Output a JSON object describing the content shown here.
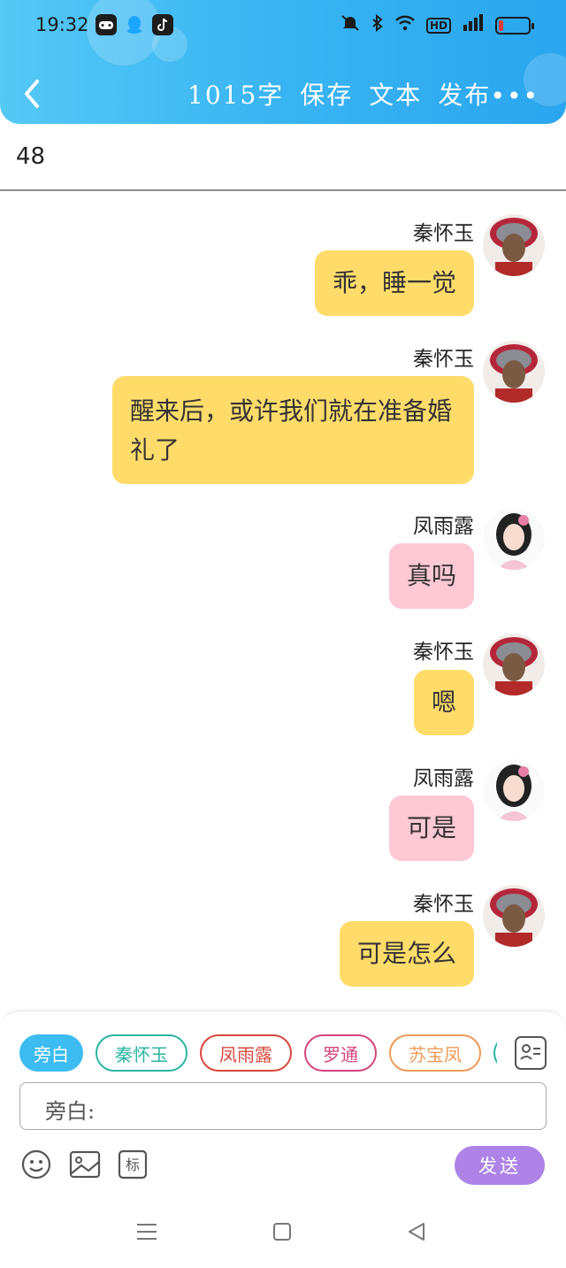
{
  "status_bar": {
    "time": "19:32",
    "left_icons": [
      "gamepad-icon",
      "qq-icon",
      "tiktok-icon"
    ],
    "right_icons": [
      "mute-icon",
      "bluetooth-icon",
      "wifi-icon",
      "hd-icon",
      "signal-icon",
      "battery-icon"
    ],
    "hd_label": "HD",
    "battery_level": 0.15
  },
  "header": {
    "word_count": "1015字",
    "save_label": "保存",
    "text_label": "文本",
    "publish_label": "发布",
    "more_label": "•••"
  },
  "title": "48",
  "messages": [
    {
      "speaker": "秦怀玉",
      "text": "乖，睡一觉",
      "color": "yellow"
    },
    {
      "speaker": "秦怀玉",
      "text": "醒来后，或许我们就在准备婚礼了",
      "color": "yellow"
    },
    {
      "speaker": "凤雨露",
      "text": "真吗",
      "color": "pink"
    },
    {
      "speaker": "秦怀玉",
      "text": "嗯",
      "color": "yellow"
    },
    {
      "speaker": "凤雨露",
      "text": "可是",
      "color": "pink"
    },
    {
      "speaker": "秦怀玉",
      "text": "可是怎么",
      "color": "yellow"
    }
  ],
  "characters": [
    "旁白",
    "秦怀玉",
    "凤雨露",
    "罗通",
    "苏宝凤"
  ],
  "input": {
    "label": "旁白:"
  },
  "tools": {
    "tag_label": "标"
  },
  "send_label": "发送",
  "colors": {
    "header": "#39b4f2",
    "bubble_yellow": "#ffdc6a",
    "bubble_pink": "#ffc9d4",
    "send": "#ad83e7"
  }
}
